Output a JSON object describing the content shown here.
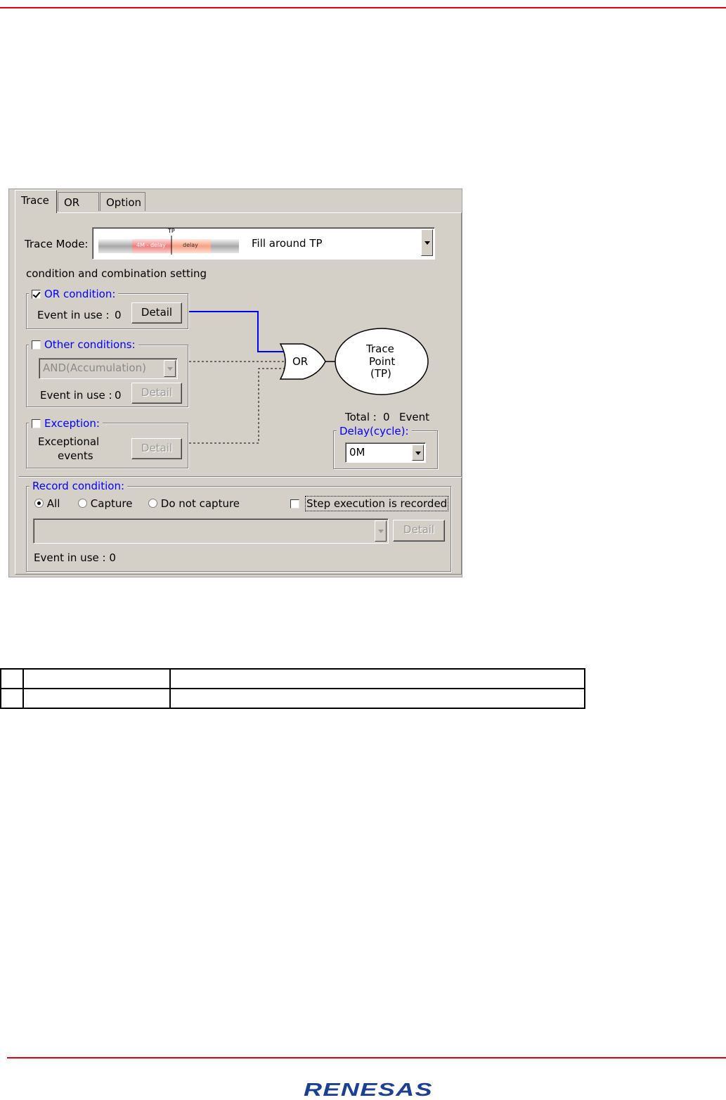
{
  "tabs": [
    {
      "label": "Trace",
      "active": true
    },
    {
      "label": "OR",
      "active": false
    },
    {
      "label": "Option",
      "active": false
    }
  ],
  "trace_mode": {
    "label": "Trace Mode:",
    "value": "Fill around TP",
    "graphic": {
      "tp": "TP",
      "left": "4M - delay",
      "right": "delay"
    }
  },
  "section_title": "condition and combination setting",
  "or_condition": {
    "label": "OR condition:",
    "checked": true,
    "event_label": "Event in use :",
    "event_count": "0",
    "detail_label": "Detail"
  },
  "other_conditions": {
    "label": "Other conditions:",
    "checked": false,
    "combo_value": "AND(Accumulation)",
    "event_label": "Event in use :",
    "event_count": "0",
    "detail_label": "Detail"
  },
  "exception": {
    "label": "Exception:",
    "checked": false,
    "text_line1": "Exceptional",
    "text_line2": "events",
    "detail_label": "Detail"
  },
  "diagram": {
    "gate_label": "OR",
    "tp_line1": "Trace",
    "tp_line2": "Point",
    "tp_line3": "(TP)",
    "total_label": "Total :",
    "total_count": "0",
    "total_unit": "Event",
    "active_color": "#0000ff"
  },
  "delay": {
    "label": "Delay(cycle):",
    "value": "0M"
  },
  "record_condition": {
    "label": "Record condition:",
    "options": [
      "All",
      "Capture",
      "Do not capture"
    ],
    "selected": "All",
    "step_label": "Step execution is recorded",
    "step_checked": false,
    "combo_value": "",
    "detail_label": "Detail",
    "event_label": "Event in use : 0"
  },
  "doc_table": {
    "rows": [
      [
        "",
        "",
        ""
      ],
      [
        "",
        "",
        ""
      ]
    ]
  },
  "logo": {
    "text": "RENESAS",
    "color": "#1a3f94"
  },
  "accent_color": "#e60012"
}
